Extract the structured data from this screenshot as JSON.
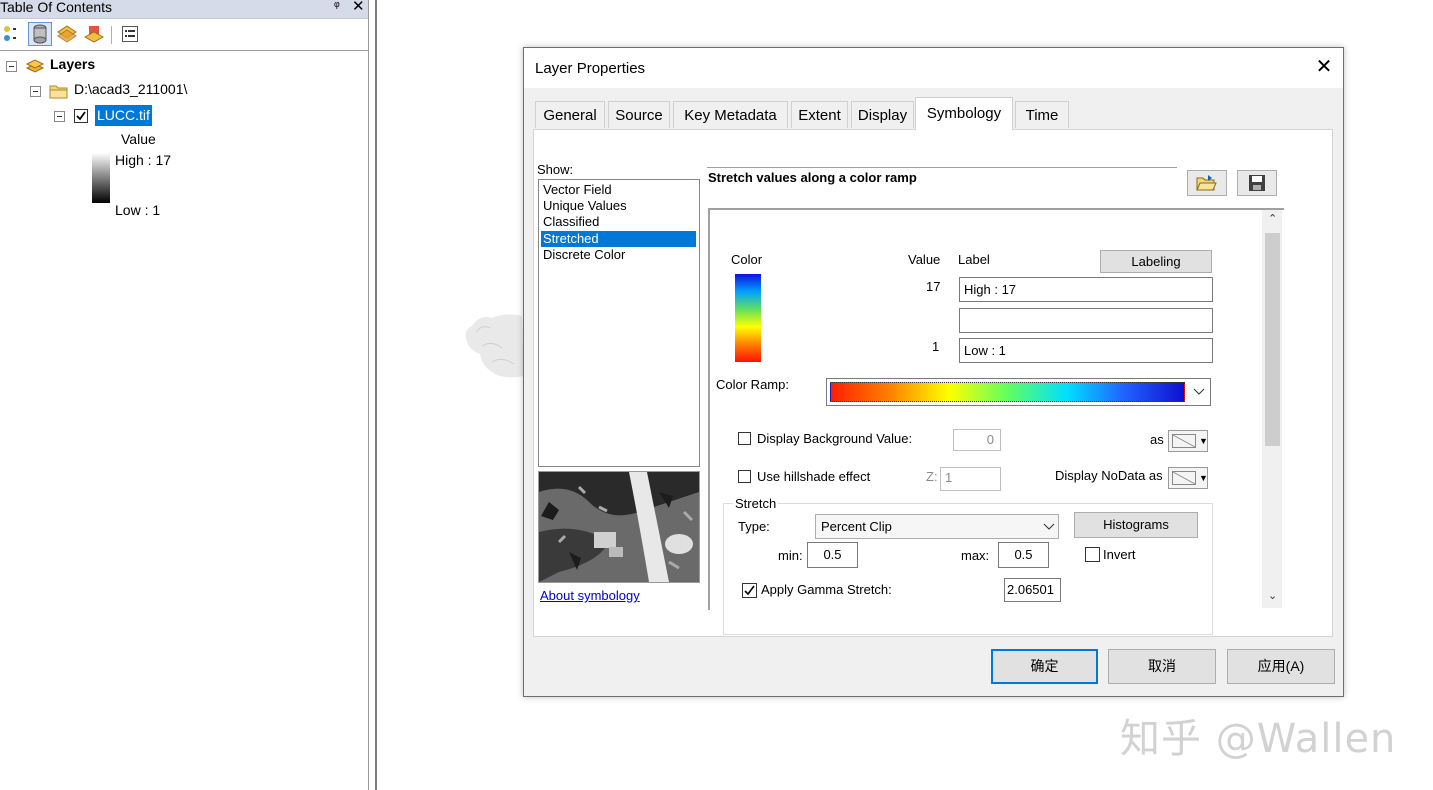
{
  "toc": {
    "title": "Table Of Contents",
    "pin_glyph": "ᵠ",
    "close_glyph": "✕",
    "layers_label": "Layers",
    "folder_label": "D:\\acad3_211001\\",
    "layer_label": "LUCC.tif",
    "legend_heading": "Value",
    "legend_high": "High : 17",
    "legend_low": "Low : 1"
  },
  "dialog": {
    "title": "Layer Properties",
    "close_glyph": "✕",
    "tabs": [
      "General",
      "Source",
      "Key Metadata",
      "Extent",
      "Display",
      "Symbology",
      "Time"
    ],
    "active_tab": "Symbology",
    "show_label": "Show:",
    "show_items": [
      "Vector Field",
      "Unique Values",
      "Classified",
      "Stretched",
      "Discrete Color"
    ],
    "show_selected": "Stretched",
    "about_link": "About symbology",
    "description": "Stretch values along a color ramp",
    "table": {
      "color_header": "Color",
      "value_header": "Value",
      "label_header": "Label",
      "labeling_button": "Labeling",
      "high_value": "17",
      "high_label": "High : 17",
      "mid_label": "",
      "low_value": "1",
      "low_label": "Low : 1"
    },
    "color_ramp_label": "Color Ramp:",
    "background": {
      "label": "Display Background Value:",
      "value": "0",
      "as_label": "as"
    },
    "hillshade": {
      "label": "Use hillshade effect",
      "z_label": "Z:",
      "z_value": "1",
      "nodata_label": "Display NoData as"
    },
    "stretch": {
      "group_label": "Stretch",
      "type_label": "Type:",
      "type_value": "Percent Clip",
      "histograms_button": "Histograms",
      "min_label": "min:",
      "min_value": "0.5",
      "max_label": "max:",
      "max_value": "0.5",
      "invert_label": "Invert",
      "gamma_label": "Apply Gamma Stretch:",
      "gamma_value": "2.06501"
    },
    "buttons": {
      "ok": "确定",
      "cancel": "取消",
      "apply": "应用(A)"
    }
  },
  "watermark": "知乎 @Wallen",
  "colors": {
    "selection": "#0078d7",
    "toc_title_bg": "#d6dbe9",
    "dialog_bg": "#f0f0f0",
    "link": "#0000cc"
  }
}
